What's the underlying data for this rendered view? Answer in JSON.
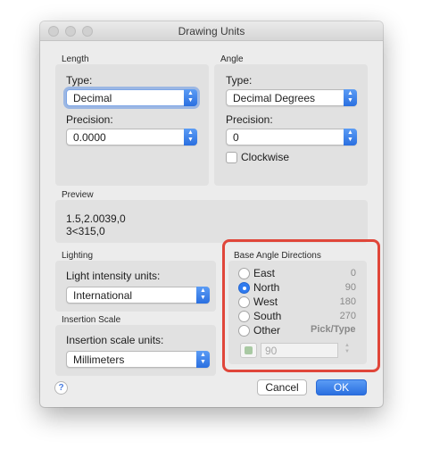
{
  "window": {
    "title": "Drawing Units"
  },
  "length": {
    "caption": "Length",
    "type_label": "Type:",
    "type_value": "Decimal",
    "precision_label": "Precision:",
    "precision_value": "0.0000"
  },
  "angle": {
    "caption": "Angle",
    "type_label": "Type:",
    "type_value": "Decimal Degrees",
    "precision_label": "Precision:",
    "precision_value": "0",
    "clockwise_label": "Clockwise",
    "clockwise_checked": false
  },
  "preview": {
    "caption": "Preview",
    "line1": "1.5,2.0039,0",
    "line2": "3<315,0"
  },
  "lighting": {
    "caption": "Lighting",
    "units_label": "Light intensity units:",
    "units_value": "International"
  },
  "insertion": {
    "caption": "Insertion Scale",
    "units_label": "Insertion scale units:",
    "units_value": "Millimeters"
  },
  "base_angle": {
    "caption": "Base Angle Directions",
    "options": [
      {
        "label": "East",
        "value": "0",
        "selected": false
      },
      {
        "label": "North",
        "value": "90",
        "selected": true
      },
      {
        "label": "West",
        "value": "180",
        "selected": false
      },
      {
        "label": "South",
        "value": "270",
        "selected": false
      },
      {
        "label": "Other",
        "value": "Pick/Type",
        "selected": false
      }
    ],
    "other_value": "90",
    "highlight_color": "#e0463a"
  },
  "buttons": {
    "cancel": "Cancel",
    "ok": "OK",
    "help": "?"
  },
  "colors": {
    "accent": "#2f7bf0",
    "panel": "#ececec",
    "group": "#e1e1e1"
  }
}
